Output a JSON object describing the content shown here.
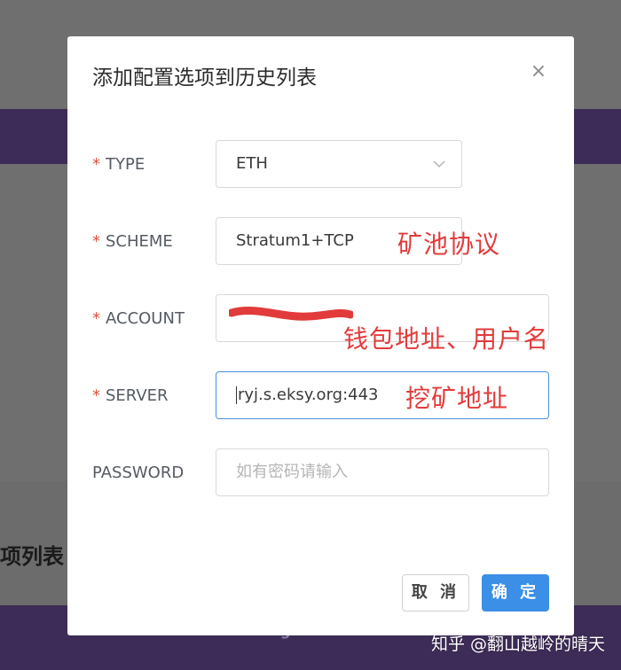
{
  "dialog": {
    "title": "添加配置选项到历史列表",
    "close_symbol": "×"
  },
  "form": {
    "type": {
      "label": "TYPE",
      "value": "ETH",
      "required": true
    },
    "scheme": {
      "label": "SCHEME",
      "value": "Stratum1+TCP",
      "required": true
    },
    "account": {
      "label": "ACCOUNT",
      "value": "",
      "required": true
    },
    "server": {
      "label": "SERVER",
      "value": "ryj.s.eksy.org:443",
      "required": true
    },
    "password": {
      "label": "PASSWORD",
      "placeholder": "如有密码请输入",
      "required": false
    }
  },
  "required_mark": "*",
  "annotations": {
    "scheme_note": "矿池协议",
    "account_note": "钱包地址、用户名",
    "server_note": "挖矿地址"
  },
  "buttons": {
    "cancel": "取 消",
    "ok": "确 定"
  },
  "background": {
    "title_fragment": "项列表",
    "footer_fragment": "Config Detail"
  },
  "watermark": "知乎 @翻山越岭的晴天",
  "colors": {
    "primary": "#3b8fe6",
    "annotation": "#e23b3b",
    "required": "#e0523d",
    "overlay_purple": "#3d2c57"
  }
}
